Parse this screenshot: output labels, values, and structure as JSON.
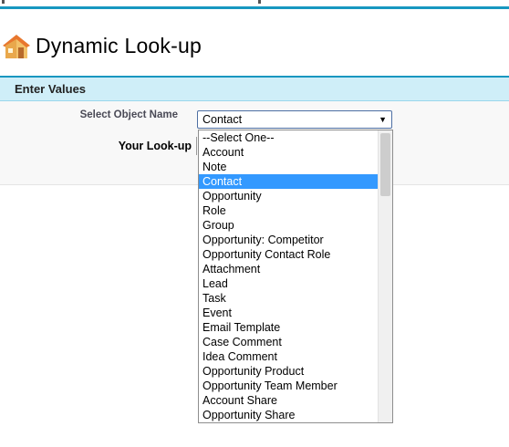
{
  "page": {
    "title": "Dynamic Look-up",
    "section_title": "Enter Values"
  },
  "form": {
    "select_label": "Select Object Name",
    "lookup_label": "Your Look-up",
    "selected_value": "Contact",
    "dropdown_arrow": "▼"
  },
  "dropdown": {
    "options": [
      "--Select One--",
      "Account",
      "Note",
      "Contact",
      "Opportunity",
      "Role",
      "Group",
      "Opportunity: Competitor",
      "Opportunity Contact Role",
      "Attachment",
      "Lead",
      "Task",
      "Event",
      "Email Template",
      "Case Comment",
      "Idea Comment",
      "Opportunity Product",
      "Opportunity Team Member",
      "Account Share",
      "Opportunity Share"
    ],
    "selected_index": 3
  },
  "colors": {
    "accent": "#1797c0",
    "section_bg": "#cfeef8",
    "selection": "#3399ff"
  },
  "icons": {
    "title_icon": "house-icon"
  }
}
